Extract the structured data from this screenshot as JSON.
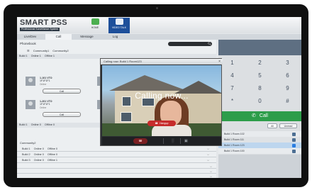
{
  "app": {
    "logo": "SMART PSS",
    "logo_sub": "Professional Surveillance System",
    "nav": [
      {
        "label": "HOME"
      },
      {
        "label": "VIDEO TALK"
      }
    ]
  },
  "tabs": [
    "Live/Dev",
    "Call",
    "Message",
    "Log"
  ],
  "phonebook": {
    "title": "Phonebook",
    "communities": [
      "Community1",
      "Community2"
    ],
    "build_row_a": [
      "Build 1",
      "Online 1",
      "Offline 1"
    ],
    "contacts": [
      {
        "name": "1-101  VTO",
        "id": "1F1F1F1",
        "state": "Online",
        "call": "Call"
      },
      {
        "name": "1-201  VTO",
        "id": "1F1F1F1",
        "state": "Online",
        "call": "Call"
      }
    ],
    "build_row_b": [
      "Build 1",
      "Online 0",
      "Offline 0"
    ],
    "community2": {
      "title": "Community2",
      "rows": [
        [
          "Build 1",
          "Online 0",
          "Offline 0"
        ],
        [
          "Build 2",
          "Online 0",
          "Offline 0"
        ],
        [
          "Build 3",
          "Online 0",
          "Offline 1"
        ]
      ]
    }
  },
  "popup": {
    "title": "Calling now: Build 1 Room123",
    "status": "Calling now...",
    "hangup": "Hangup"
  },
  "dialpad": {
    "keys": [
      "1",
      "2",
      "3",
      "4",
      "5",
      "6",
      "7",
      "8",
      "9",
      "*",
      "0",
      "#"
    ],
    "call": "Call",
    "filter_all": "All",
    "filter_unread": "Unread",
    "log": [
      "Build 1  Room 102",
      "Build 1  Room 111",
      "Build 1  Room 123",
      "Build 1  Room 100"
    ]
  },
  "colors": {
    "accent_blue": "#1d4f9a",
    "call_green": "#2d9d4a",
    "hangup_red": "#c62b2b",
    "selected_row": "#bdd6ee"
  }
}
